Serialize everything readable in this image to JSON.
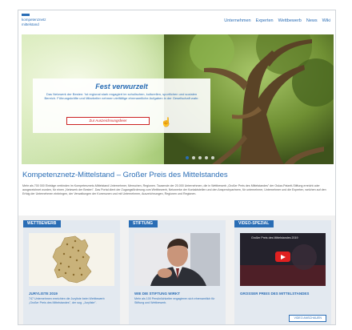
{
  "header": {
    "logo_line1": "kompetenznetz",
    "logo_line2": "mittelstand",
    "nav": [
      "Unternehmen",
      "Experten",
      "Wettbewerb",
      "News",
      "Wiki"
    ]
  },
  "hero": {
    "title": "Fest verwurzelt",
    "text": "Das Netzwerk der Besten: 'ist regional stark engagiert im schulischen, kulturellen, sportlichen und sozialen Bereich. Führungskräfte und Mitarbeiter nehmen vielfältige ehrenamtliche Aufgaben in der Gesellschaft wahr.",
    "button": "Zur Auszeichnungsfeier",
    "slide_count": 5,
    "active_slide": 1
  },
  "main": {
    "headline": "Kompetenznetz-Mittelstand – Großer Preis des Mittelstandes",
    "intro": "Mehr als 700 000 Einträge verbinden im Kompetenznetz-Mittelstand Unternehmer, Menschen, Regionen. Tausende der 20.000 Unternehmen, die in Wettbewerb „Großer Preis des Mittelstandes\" der Oskar-Patzelt-Stiftung erreicht oder ausgezeichnet wurden, für einen „Netzwerk der Besten\". Das Portal dient der Zugangsförderung zum Wettbewerb, Netzwerke der Kontaktstellen und den Ansprechpartnern, für unternehmer, Unternehmer und die Experten, welchen auf den Erfolg der Unternehmen einbringen, der Verwaltungen der Kommunen und mit Unternehmen, Auszeichnungen, Regionen und Regionen."
  },
  "cards": [
    {
      "tag": "WETTBEWERB",
      "title": "JURYLISTE 2019",
      "text": "747 Unternehmen erreichten die Juryliste beim Wettbewerb „Großer Preis des Mittelstandes\", der sog. „Juryliste\"."
    },
    {
      "tag": "STIFTUNG",
      "title": "WIE DIE STIFTUNG WIRKT",
      "text": "Mehr als 100 Persönlichkeiter engagieren sich ehrenamtlich für Stiftung und Wettbewerb."
    },
    {
      "tag": "VIDEO-SPEZIAL",
      "title": "GROSSER PREIS DES MITTELSTANDES",
      "text": "",
      "video_title": "Großer Preis des Mittelstandes 2019",
      "button": "VIDEO ANSCHAUEN"
    }
  ],
  "colors": {
    "brand": "#2a6db5",
    "accent_red": "#cc2222",
    "card_bg": "#e3e9f0"
  }
}
